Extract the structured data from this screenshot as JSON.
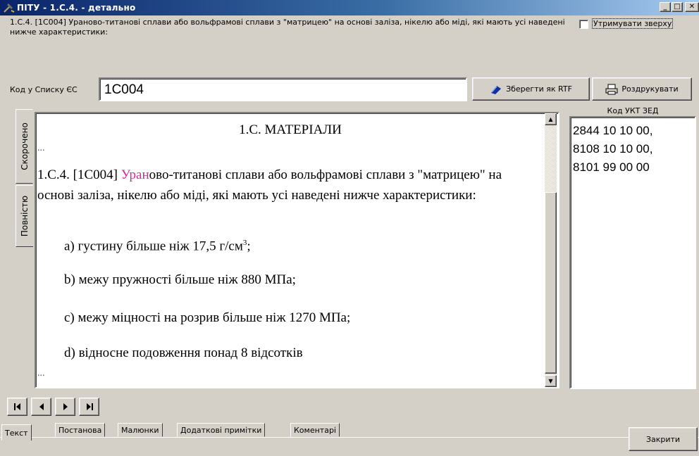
{
  "window": {
    "title": "ПІТУ - 1.С.4. - детально",
    "controls": {
      "minimize": "_",
      "maximize": "□",
      "close": "✕"
    }
  },
  "description": "1.С.4. [1С004] Ураново-титанові сплави або вольфрамові сплави з \"матрицею\" на основі заліза, нікелю або міді, які мають усі наведені нижче характеристики:",
  "stay_on_top": {
    "label": "Утримувати зверху",
    "checked": false
  },
  "code": {
    "label": "Код у Списку ЄС",
    "value": "1С004"
  },
  "buttons": {
    "save_rtf": "Зберегти як RTF",
    "print": "Роздрукувати",
    "close": "Закрити"
  },
  "side_tabs": {
    "short": "Скорочено",
    "full": "Повністю"
  },
  "document": {
    "heading": "1.С. МАТЕРІАЛИ",
    "ellipsis_top": "...",
    "para_prefix": "1.С.4. [1С004] ",
    "para_highlight": "Уран",
    "para_rest": "ово-титанові сплави або вольфрамові сплави з \"матрицею\" на основі заліза, нікелю або міді, які мають усі наведені нижче характеристики:",
    "items": [
      {
        "text": "a) густину більше ніж 17,5 г/см",
        "sup": "3",
        "tail": ";"
      },
      {
        "text": "b) межу пружності більше ніж 880 МПа;",
        "sup": "",
        "tail": ""
      },
      {
        "text": "c) межу міцності на розрив більше ніж 1270 МПа;",
        "sup": "",
        "tail": ""
      },
      {
        "text": "d) відносне подовження понад 8 відсотків",
        "sup": "",
        "tail": ""
      }
    ],
    "ellipsis_bottom": "..."
  },
  "ukt": {
    "header": "Код УКТ ЗЕД",
    "codes": [
      "2844 10 10 00,",
      "8108 10 10 00,",
      "8101 99 00 00"
    ]
  },
  "nav": [
    "first-icon",
    "prev-icon",
    "next-icon",
    "last-icon"
  ],
  "bottom_tabs": [
    "Текст",
    "Постанова",
    "Малюнки",
    "Додаткові примітки",
    "Коментарі"
  ],
  "colors": {
    "highlight": "#e020a0",
    "titlebar": "#0a246a"
  }
}
